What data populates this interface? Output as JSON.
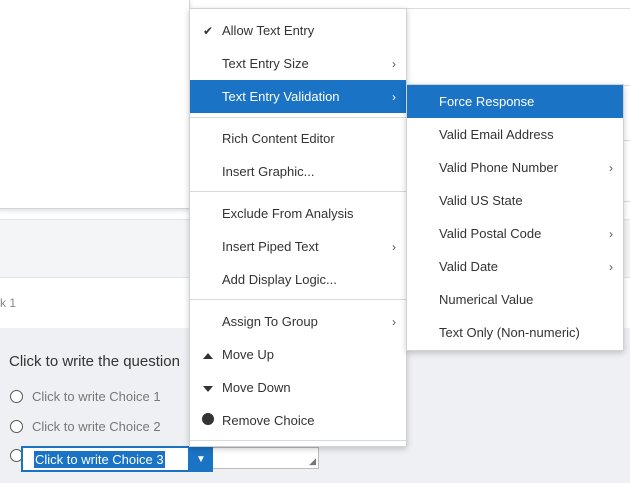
{
  "page": {
    "page_indicator": "k 1",
    "question_placeholder": "Click to write the question"
  },
  "choices": [
    {
      "label": "Click to write Choice 1"
    },
    {
      "label": "Click to write Choice 2"
    },
    {
      "label": "Click to write Choice 3"
    }
  ],
  "editor": {
    "selected_text": "Click to write Choice 3",
    "dropdown_icon": "caret-down-icon"
  },
  "context_menu": {
    "items": [
      {
        "label": "Allow Text Entry",
        "icon": "checkmark-icon",
        "checked": true
      },
      {
        "label": "Text Entry Size",
        "has_submenu": true
      },
      {
        "label": "Text Entry Validation",
        "has_submenu": true,
        "active": true
      },
      {
        "label": "Rich Content Editor"
      },
      {
        "label": "Insert Graphic..."
      },
      {
        "label": "Exclude From Analysis"
      },
      {
        "label": "Insert Piped Text",
        "has_submenu": true
      },
      {
        "label": "Add Display Logic..."
      },
      {
        "label": "Assign To Group",
        "has_submenu": true
      },
      {
        "label": "Move Up",
        "icon": "triangle-up-icon"
      },
      {
        "label": "Move Down",
        "icon": "triangle-down-icon"
      },
      {
        "label": "Remove Choice",
        "icon": "remove-circle-icon"
      }
    ]
  },
  "validation_submenu": {
    "items": [
      {
        "label": "Force Response",
        "active": true
      },
      {
        "label": "Valid Email Address"
      },
      {
        "label": "Valid Phone Number",
        "has_submenu": true
      },
      {
        "label": "Valid US State"
      },
      {
        "label": "Valid Postal Code",
        "has_submenu": true
      },
      {
        "label": "Valid Date",
        "has_submenu": true
      },
      {
        "label": "Numerical Value"
      },
      {
        "label": "Text Only (Non-numeric)"
      }
    ]
  },
  "colors": {
    "accent": "#1a73c4",
    "background": "#eef0f3"
  }
}
